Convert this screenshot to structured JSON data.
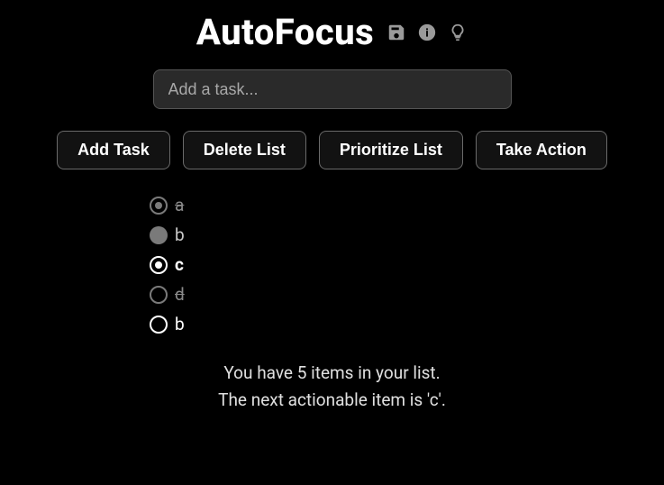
{
  "header": {
    "title": "AutoFocus",
    "icons": {
      "save": "save-icon",
      "info": "info-icon",
      "tip": "lightbulb-icon"
    }
  },
  "input": {
    "placeholder": "Add a task..."
  },
  "buttons": {
    "add": "Add Task",
    "delete": "Delete List",
    "prioritize": "Prioritize List",
    "action": "Take Action"
  },
  "tasks": [
    {
      "label": "a",
      "state": "marked-done",
      "style_label": "dim-strike",
      "circle": "outline-gray-dot"
    },
    {
      "label": "b",
      "state": "done",
      "style_label": "gray",
      "circle": "filled-gray"
    },
    {
      "label": "c",
      "state": "current",
      "style_label": "bold",
      "circle": "outline-white-dot"
    },
    {
      "label": "d",
      "state": "skipped",
      "style_label": "dim-strike",
      "circle": "outline-gray"
    },
    {
      "label": "b",
      "state": "pending",
      "style_label": "white",
      "circle": "outline-white"
    }
  ],
  "status": {
    "line1": "You have 5 items in your list.",
    "line2": "The next actionable item is 'c'."
  }
}
